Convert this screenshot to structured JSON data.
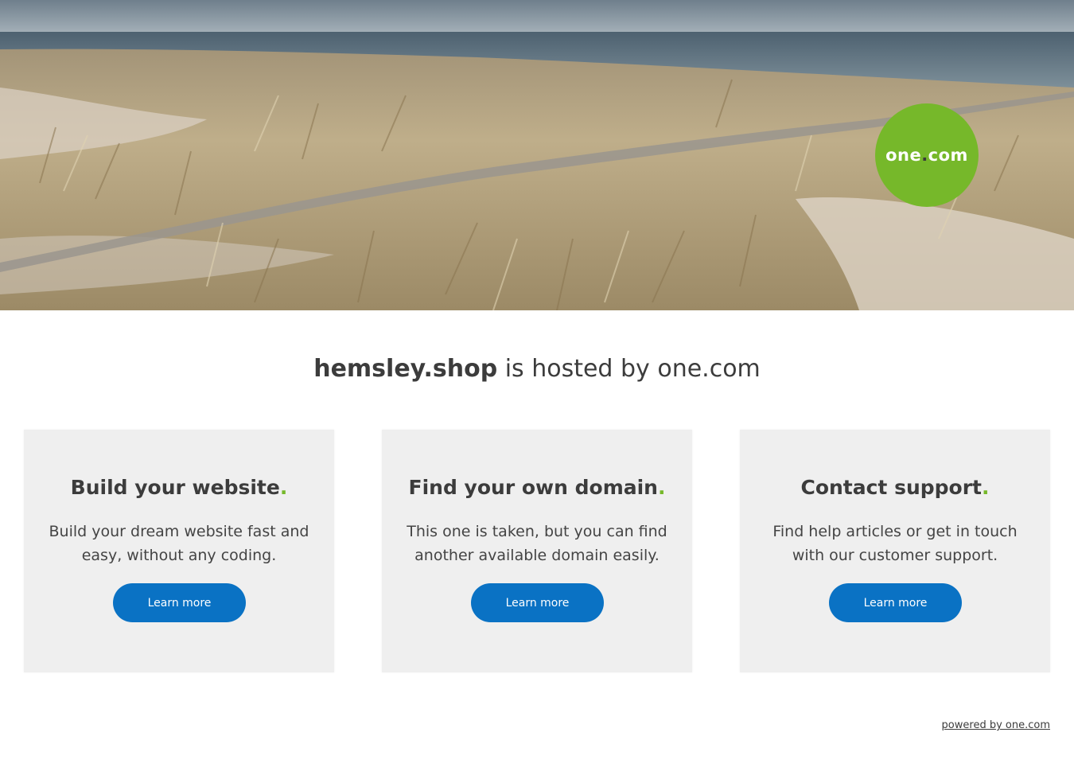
{
  "hero": {
    "logo": {
      "text_before_dot": "one",
      "dot": ".",
      "text_after_dot": "com"
    },
    "colors": {
      "logo_green": "#76b82a",
      "sky": "#7a8a97",
      "sea": "#5c6f7c",
      "grass": "#b9a47c",
      "sand": "#d8cfc2"
    }
  },
  "headline": {
    "domain": "hemsley.shop",
    "rest": " is hosted by one.com"
  },
  "cards": [
    {
      "title": "Build your website",
      "dot": ".",
      "text": "Build your dream website fast and easy, without any coding.",
      "button": "Learn more"
    },
    {
      "title": "Find your own domain",
      "dot": ".",
      "text": "This one is taken, but you can find another available domain easily.",
      "button": "Learn more"
    },
    {
      "title": "Contact support",
      "dot": ".",
      "text": "Find help articles or get in touch with our customer support.",
      "button": "Learn more"
    }
  ],
  "footer": {
    "powered_by": "powered by one.com"
  },
  "colors": {
    "button_blue": "#0a72c4",
    "card_bg": "#efefef",
    "accent_green": "#76b82a"
  }
}
